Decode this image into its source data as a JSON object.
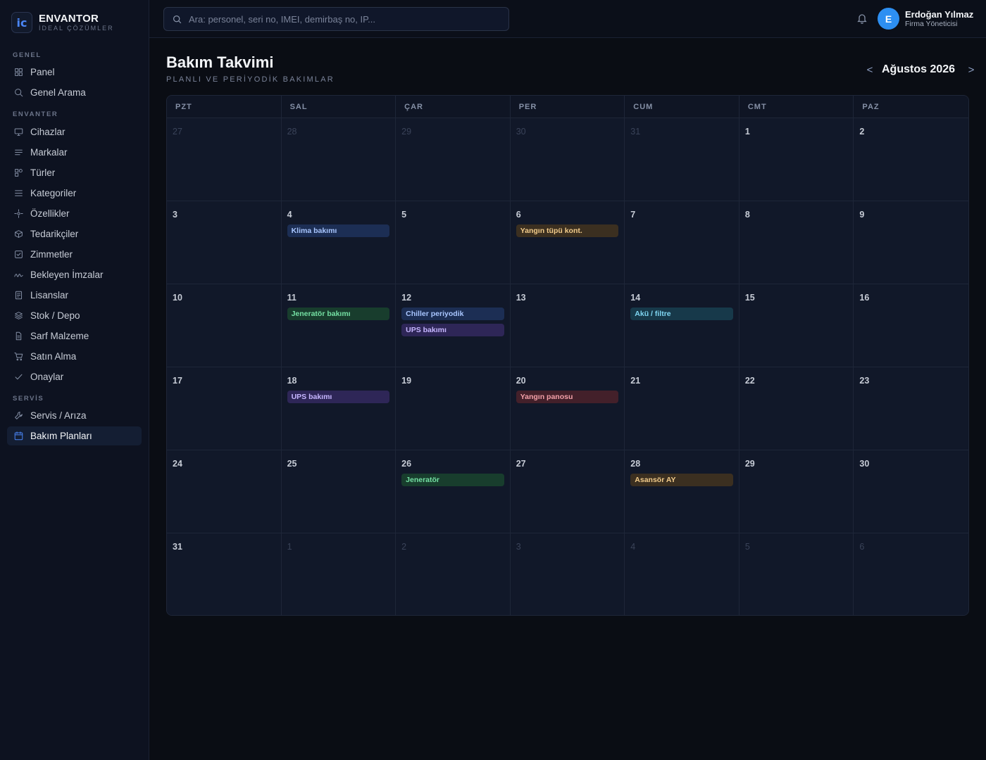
{
  "brand": {
    "logo": "ic",
    "name": "ENVANTOR",
    "tagline": "İDEAL ÇÖZÜMLER"
  },
  "sidebar": {
    "sections": [
      {
        "label": "GENEL",
        "items": [
          {
            "label": "Panel",
            "icon": "grid-icon"
          },
          {
            "label": "Genel Arama",
            "icon": "search-icon"
          }
        ]
      },
      {
        "label": "ENVANTER",
        "items": [
          {
            "label": "Cihazlar",
            "icon": "monitor-icon"
          },
          {
            "label": "Markalar",
            "icon": "lines-icon"
          },
          {
            "label": "Türler",
            "icon": "shapes-icon"
          },
          {
            "label": "Kategoriler",
            "icon": "list-icon"
          },
          {
            "label": "Özellikler",
            "icon": "sparkle-icon"
          },
          {
            "label": "Tedarikçiler",
            "icon": "box-icon"
          },
          {
            "label": "Zimmetler",
            "icon": "check-square-icon"
          },
          {
            "label": "Bekleyen İmzalar",
            "icon": "signature-icon"
          },
          {
            "label": "Lisanslar",
            "icon": "document-icon"
          },
          {
            "label": "Stok / Depo",
            "icon": "layers-icon"
          },
          {
            "label": "Sarf Malzeme",
            "icon": "file-icon"
          },
          {
            "label": "Satın Alma",
            "icon": "cart-icon"
          },
          {
            "label": "Onaylar",
            "icon": "check-icon"
          }
        ]
      },
      {
        "label": "SERVİS",
        "items": [
          {
            "label": "Servis / Arıza",
            "icon": "wrench-icon"
          },
          {
            "label": "Bakım Planları",
            "icon": "calendar-icon",
            "active": true
          }
        ]
      }
    ]
  },
  "topbar": {
    "search_placeholder": "Ara: personel, seri no, IMEI, demirbaş no, IP...",
    "user": {
      "initial": "E",
      "name": "Erdoğan Yılmaz",
      "role": "Firma Yöneticisi"
    }
  },
  "page": {
    "title": "Bakım Takvimi",
    "subtitle": "PLANLI VE PERİYODİK BAKIMLAR",
    "month": "Ağustos 2026",
    "prev": "<",
    "next": ">"
  },
  "calendar": {
    "weekdays": [
      "PZT",
      "SAL",
      "ÇAR",
      "PER",
      "CUM",
      "CMT",
      "PAZ"
    ],
    "days": [
      {
        "d": "27",
        "muted": true
      },
      {
        "d": "28",
        "muted": true
      },
      {
        "d": "29",
        "muted": true
      },
      {
        "d": "30",
        "muted": true
      },
      {
        "d": "31",
        "muted": true
      },
      {
        "d": "1"
      },
      {
        "d": "2"
      },
      {
        "d": "3"
      },
      {
        "d": "4",
        "events": [
          {
            "label": "Klima bakımı",
            "color": "blue"
          }
        ]
      },
      {
        "d": "5"
      },
      {
        "d": "6",
        "events": [
          {
            "label": "Yangın tüpü kont.",
            "color": "amber"
          }
        ]
      },
      {
        "d": "7"
      },
      {
        "d": "8"
      },
      {
        "d": "9"
      },
      {
        "d": "10"
      },
      {
        "d": "11",
        "events": [
          {
            "label": "Jeneratör bakımı",
            "color": "green"
          }
        ]
      },
      {
        "d": "12",
        "events": [
          {
            "label": "Chiller periyodik",
            "color": "blue"
          },
          {
            "label": "UPS bakımı",
            "color": "purple"
          }
        ]
      },
      {
        "d": "13"
      },
      {
        "d": "14",
        "events": [
          {
            "label": "Akü / filtre",
            "color": "teal"
          }
        ]
      },
      {
        "d": "15"
      },
      {
        "d": "16"
      },
      {
        "d": "17"
      },
      {
        "d": "18",
        "events": [
          {
            "label": "UPS bakımı",
            "color": "purple"
          }
        ]
      },
      {
        "d": "19"
      },
      {
        "d": "20",
        "events": [
          {
            "label": "Yangın panosu",
            "color": "red"
          }
        ]
      },
      {
        "d": "21"
      },
      {
        "d": "22"
      },
      {
        "d": "23"
      },
      {
        "d": "24"
      },
      {
        "d": "25"
      },
      {
        "d": "26",
        "events": [
          {
            "label": "Jeneratör",
            "color": "green"
          }
        ]
      },
      {
        "d": "27"
      },
      {
        "d": "28",
        "events": [
          {
            "label": "Asansör AY",
            "color": "amber"
          }
        ]
      },
      {
        "d": "29"
      },
      {
        "d": "30"
      },
      {
        "d": "31"
      },
      {
        "d": "1",
        "muted": true
      },
      {
        "d": "2",
        "muted": true
      },
      {
        "d": "3",
        "muted": true
      },
      {
        "d": "4",
        "muted": true
      },
      {
        "d": "5",
        "muted": true
      },
      {
        "d": "6",
        "muted": true
      }
    ]
  }
}
